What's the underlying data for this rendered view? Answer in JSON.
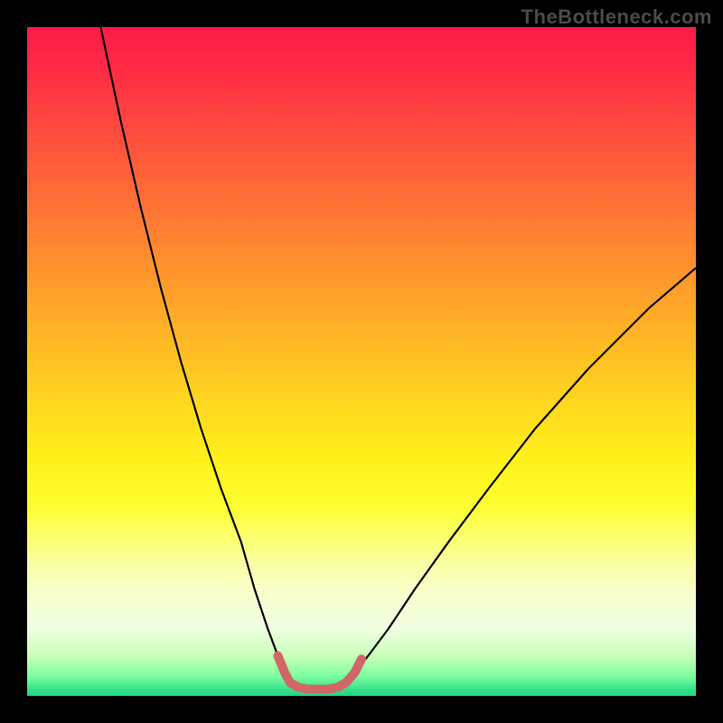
{
  "watermark": "TheBottleneck.com",
  "chart_data": {
    "type": "line",
    "title": "",
    "xlabel": "",
    "ylabel": "",
    "xlim": [
      0,
      100
    ],
    "ylim": [
      0,
      100
    ],
    "gradient_stops": [
      {
        "pct": 0,
        "color": "#ff1a49"
      },
      {
        "pct": 15,
        "color": "#ff4a3e"
      },
      {
        "pct": 35,
        "color": "#ff8f2e"
      },
      {
        "pct": 55,
        "color": "#ffd320"
      },
      {
        "pct": 72,
        "color": "#fcff33"
      },
      {
        "pct": 85,
        "color": "#f8ffd0"
      },
      {
        "pct": 97,
        "color": "#7effa0"
      },
      {
        "pct": 100,
        "color": "#1fd87f"
      }
    ],
    "series": [
      {
        "name": "left-curve",
        "stroke": "#000000",
        "stroke_width": 2.2,
        "x": [
          11,
          14,
          17,
          20,
          23,
          26,
          29,
          32,
          34,
          36,
          37.5,
          38.5,
          39.3
        ],
        "y": [
          100,
          86,
          73,
          61,
          50,
          40,
          31,
          23,
          16,
          10,
          6,
          3.5,
          2
        ]
      },
      {
        "name": "right-curve",
        "stroke": "#000000",
        "stroke_width": 2.2,
        "x": [
          47.7,
          49,
          51,
          54,
          58,
          63,
          69,
          76,
          84,
          93,
          100
        ],
        "y": [
          2,
          3.5,
          6,
          10,
          16,
          23,
          31,
          40,
          49,
          58,
          64
        ]
      },
      {
        "name": "bottom-highlight",
        "stroke": "#d16666",
        "stroke_width": 10,
        "linecap": "round",
        "x": [
          37.5,
          38.5,
          39.3,
          40.5,
          42,
          43.5,
          45,
          46.5,
          47.7,
          49,
          50
        ],
        "y": [
          6,
          3.5,
          2,
          1.3,
          1.0,
          1.0,
          1.0,
          1.3,
          2,
          3.5,
          5.5
        ]
      }
    ]
  }
}
